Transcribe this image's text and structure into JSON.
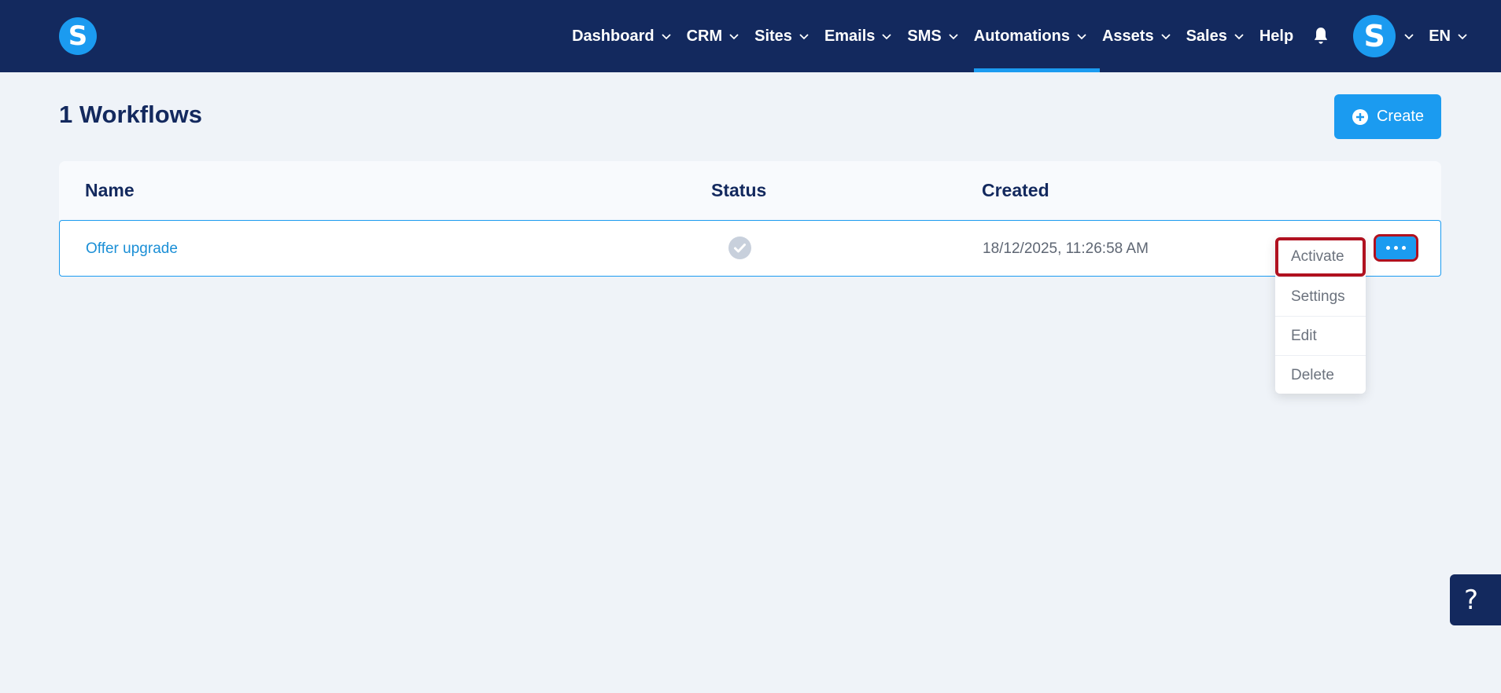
{
  "nav": {
    "logo_letter": "S",
    "items": [
      {
        "label": "Dashboard"
      },
      {
        "label": "CRM"
      },
      {
        "label": "Sites"
      },
      {
        "label": "Emails"
      },
      {
        "label": "SMS"
      },
      {
        "label": "Automations",
        "active": true
      },
      {
        "label": "Assets"
      },
      {
        "label": "Sales"
      },
      {
        "label": "Help"
      }
    ],
    "avatar_letter": "S",
    "language": "EN"
  },
  "page": {
    "title": "1 Workflows",
    "create_label": "Create"
  },
  "table": {
    "headers": {
      "name": "Name",
      "status": "Status",
      "created": "Created"
    },
    "rows": [
      {
        "name": "Offer upgrade",
        "status_icon": "check-circle-icon",
        "created": "18/12/2025, 11:26:58 AM"
      }
    ]
  },
  "menu": {
    "items": [
      {
        "label": "Activate"
      },
      {
        "label": "Settings"
      },
      {
        "label": "Edit"
      },
      {
        "label": "Delete"
      }
    ]
  },
  "help": {
    "label": "?"
  },
  "colors": {
    "nav_bg": "#13295e",
    "accent": "#1b9bf0",
    "page_bg": "#eff3f8",
    "highlight": "#b0111f"
  }
}
